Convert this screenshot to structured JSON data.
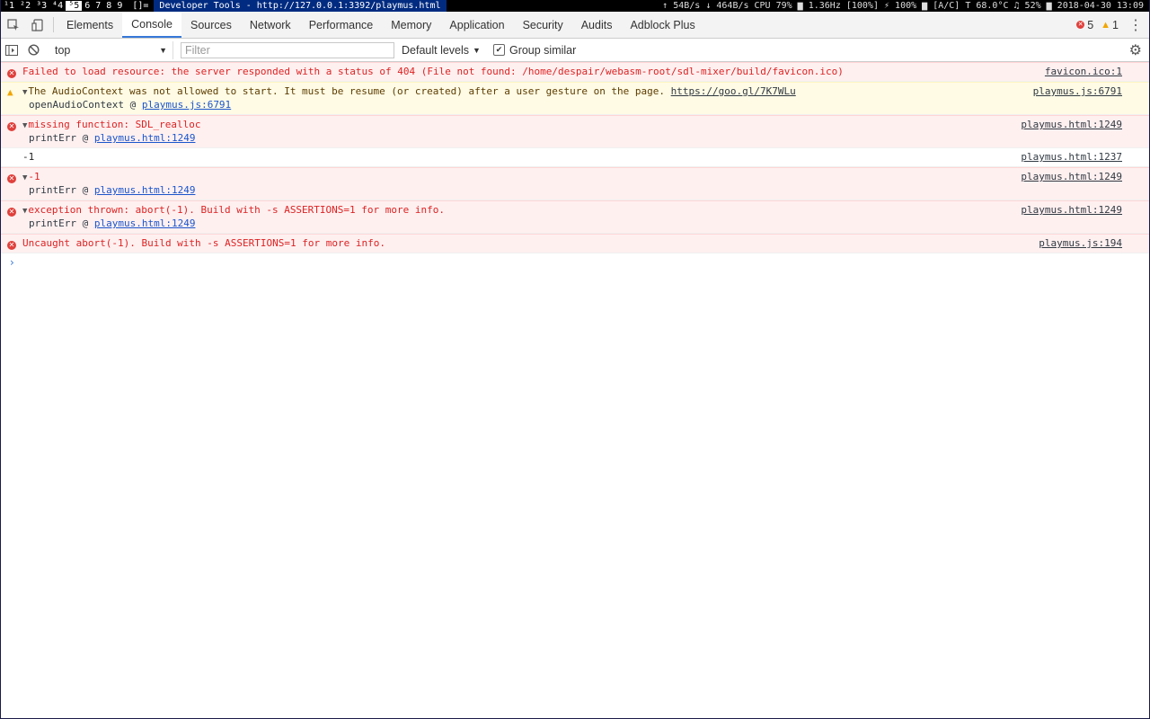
{
  "sysbar": {
    "workspaces": [
      "¹1",
      "²2",
      "³3",
      "⁴4",
      "⁵5",
      "6",
      "7",
      "8",
      "9"
    ],
    "active_workspace_index": 4,
    "layout": "[]=",
    "window_title": "Developer Tools - http://127.0.0.1:3392/playmus.html",
    "status": "↑ 54B/s ↓ 464B/s CPU 79% ▆ 1.36Hz [100%] ⚡ 100% ▆ [A/C] T 68.0°C ♫ 52% ▆ 2018-04-30 13:09"
  },
  "tabs": [
    "Elements",
    "Console",
    "Sources",
    "Network",
    "Performance",
    "Memory",
    "Application",
    "Security",
    "Audits",
    "Adblock Plus"
  ],
  "selected_tab": "Console",
  "counters": {
    "errors": "5",
    "warnings": "1"
  },
  "toolbar": {
    "context": "top",
    "filter_placeholder": "Filter",
    "levels": "Default levels",
    "group_similar": "Group similar",
    "group_similar_checked": true
  },
  "messages": [
    {
      "level": "error",
      "expand": false,
      "text": "Failed to load resource: the server responded with a status of 404 (File not found: /home/despair/webasm-root/sdl-mixer/build/favicon.ico)",
      "source": "favicon.ico:1",
      "stack": []
    },
    {
      "level": "warning",
      "expand": true,
      "text": "The AudioContext was not allowed to start. It must be resume (or created) after a user gesture on the page. ",
      "link": "https://goo.gl/7K7WLu",
      "source": "playmus.js:6791",
      "stack": [
        {
          "fn": "openAudioContext",
          "loc": "playmus.js:6791"
        }
      ]
    },
    {
      "level": "error",
      "expand": true,
      "text": "missing function: SDL_realloc",
      "source": "playmus.html:1249",
      "stack": [
        {
          "fn": "printErr",
          "loc": "playmus.html:1249"
        }
      ]
    },
    {
      "level": "log",
      "expand": false,
      "text": "-1",
      "source": "playmus.html:1237",
      "stack": []
    },
    {
      "level": "error",
      "expand": true,
      "text": "-1",
      "source": "playmus.html:1249",
      "stack": [
        {
          "fn": "printErr",
          "loc": "playmus.html:1249"
        }
      ]
    },
    {
      "level": "error",
      "expand": true,
      "text": "exception thrown: abort(-1). Build with -s ASSERTIONS=1 for more info.",
      "source": "playmus.html:1249",
      "stack": [
        {
          "fn": "printErr",
          "loc": "playmus.html:1249"
        }
      ]
    },
    {
      "level": "error",
      "expand": false,
      "text": "Uncaught abort(-1). Build with -s ASSERTIONS=1 for more info.",
      "source": "playmus.js:194",
      "stack": []
    }
  ],
  "prompt_symbol": "›"
}
